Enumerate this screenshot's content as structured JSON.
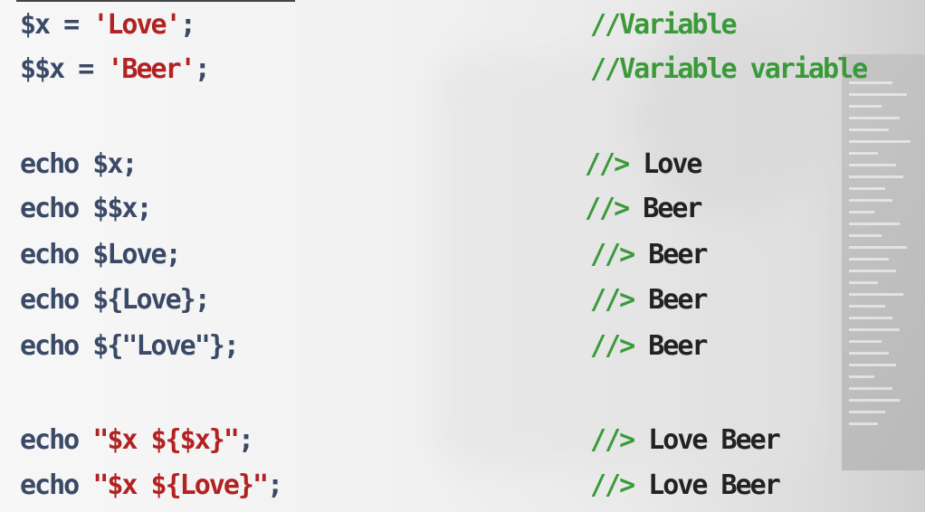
{
  "code_lines": [
    {
      "left": [
        {
          "t": "$x = ",
          "c": "plain"
        },
        {
          "t": "'Love'",
          "c": "str"
        },
        {
          "t": ";",
          "c": "plain"
        }
      ],
      "comment": "//Variable",
      "output": ""
    },
    {
      "left": [
        {
          "t": "$$x = ",
          "c": "plain"
        },
        {
          "t": "'Beer'",
          "c": "str"
        },
        {
          "t": ";",
          "c": "plain"
        }
      ],
      "comment": "//Variable variable",
      "output": ""
    },
    {
      "left": [
        {
          "t": "echo $x;",
          "c": "plain"
        }
      ],
      "comment": "//>",
      "output": " Love"
    },
    {
      "left": [
        {
          "t": "echo $$x;",
          "c": "plain"
        }
      ],
      "comment": "//>",
      "output": " Beer"
    },
    {
      "left": [
        {
          "t": "echo $Love;",
          "c": "plain"
        }
      ],
      "comment": "//>",
      "output": " Beer"
    },
    {
      "left": [
        {
          "t": "echo ${Love};",
          "c": "plain"
        }
      ],
      "comment": "//>",
      "output": " Beer"
    },
    {
      "left": [
        {
          "t": "echo ${\"Love\"};",
          "c": "plain"
        }
      ],
      "comment": "//>",
      "output": " Beer"
    },
    {
      "left": [
        {
          "t": "echo ",
          "c": "plain"
        },
        {
          "t": "\"$x ${$x}\"",
          "c": "str"
        },
        {
          "t": ";",
          "c": "plain"
        }
      ],
      "comment": "//>",
      "output": " Love Beer"
    },
    {
      "left": [
        {
          "t": "echo ",
          "c": "plain"
        },
        {
          "t": "\"$x ${Love}\"",
          "c": "str"
        },
        {
          "t": ";",
          "c": "plain"
        }
      ],
      "comment": "//>",
      "output": " Love Beer"
    }
  ],
  "colors": {
    "code": "#3a4a66",
    "string": "#b22222",
    "comment": "#3a9a3a",
    "output": "#222222"
  }
}
